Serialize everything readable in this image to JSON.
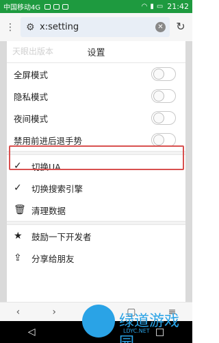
{
  "statusbar": {
    "carrier": "中国移动4G",
    "battery": "",
    "time": "21:42"
  },
  "addressbar": {
    "url": "x:setting"
  },
  "panel": {
    "title": "设置",
    "ghost_text": "天眼出版本",
    "toggles": [
      {
        "label": "全屏模式"
      },
      {
        "label": "隐私模式"
      },
      {
        "label": "夜间模式"
      },
      {
        "label": "禁用前进后退手势"
      }
    ],
    "actions": [
      {
        "label": "切换UA"
      },
      {
        "label": "切换搜索引擎"
      },
      {
        "label": "清理数据"
      }
    ],
    "extras": [
      {
        "label": "鼓励一下开发者"
      },
      {
        "label": "分享给朋友"
      }
    ]
  },
  "watermark": {
    "text": "绿道游戏园",
    "url": "LDYC.NET"
  }
}
